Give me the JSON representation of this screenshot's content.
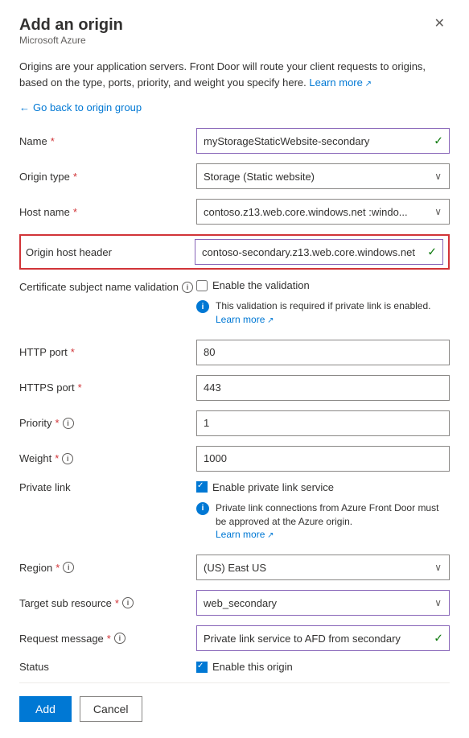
{
  "panel": {
    "title": "Add an origin",
    "subtitle": "Microsoft Azure",
    "close_label": "✕"
  },
  "description": {
    "text": "Origins are your application servers. Front Door will route your client requests to origins, based on the type, ports, priority, and weight you specify here.",
    "learn_more": "Learn more"
  },
  "back_link": "Go back to origin group",
  "form": {
    "name": {
      "label": "Name",
      "required": true,
      "value": "myStorageStaticWebsite-secondary",
      "has_check": true
    },
    "origin_type": {
      "label": "Origin type",
      "required": true,
      "value": "Storage (Static website)"
    },
    "host_name": {
      "label": "Host name",
      "required": true,
      "value": "contoso.z13.web.core.windows.net  :windo..."
    },
    "origin_host_header": {
      "label": "Origin host header",
      "value": "contoso-secondary.z13.web.core.windows.net",
      "has_check": true
    },
    "cert_validation": {
      "label": "Certificate subject name validation",
      "checkbox_label": "Enable the validation",
      "info_text": "This validation is required if private link is enabled.",
      "info_learn_more": "Learn more"
    },
    "http_port": {
      "label": "HTTP port",
      "required": true,
      "value": "80"
    },
    "https_port": {
      "label": "HTTPS port",
      "required": true,
      "value": "443"
    },
    "priority": {
      "label": "Priority",
      "required": true,
      "value": "1"
    },
    "weight": {
      "label": "Weight",
      "required": true,
      "value": "1000"
    },
    "private_link": {
      "label": "Private link",
      "checkbox_label": "Enable private link service",
      "info_text": "Private link connections from Azure Front Door must be approved at the Azure origin.",
      "info_learn_more": "Learn more"
    },
    "region": {
      "label": "Region",
      "required": true,
      "value": "(US) East US"
    },
    "target_sub_resource": {
      "label": "Target sub resource",
      "required": true,
      "value": "web_secondary"
    },
    "request_message": {
      "label": "Request message",
      "required": true,
      "value": "Private link service to AFD from secondary",
      "has_check": true
    },
    "status": {
      "label": "Status",
      "checkbox_label": "Enable this origin"
    }
  },
  "footer": {
    "add_label": "Add",
    "cancel_label": "Cancel"
  },
  "icons": {
    "info": "i",
    "check": "✓",
    "close": "✕",
    "back_arrow": "←",
    "external_link": "↗"
  }
}
